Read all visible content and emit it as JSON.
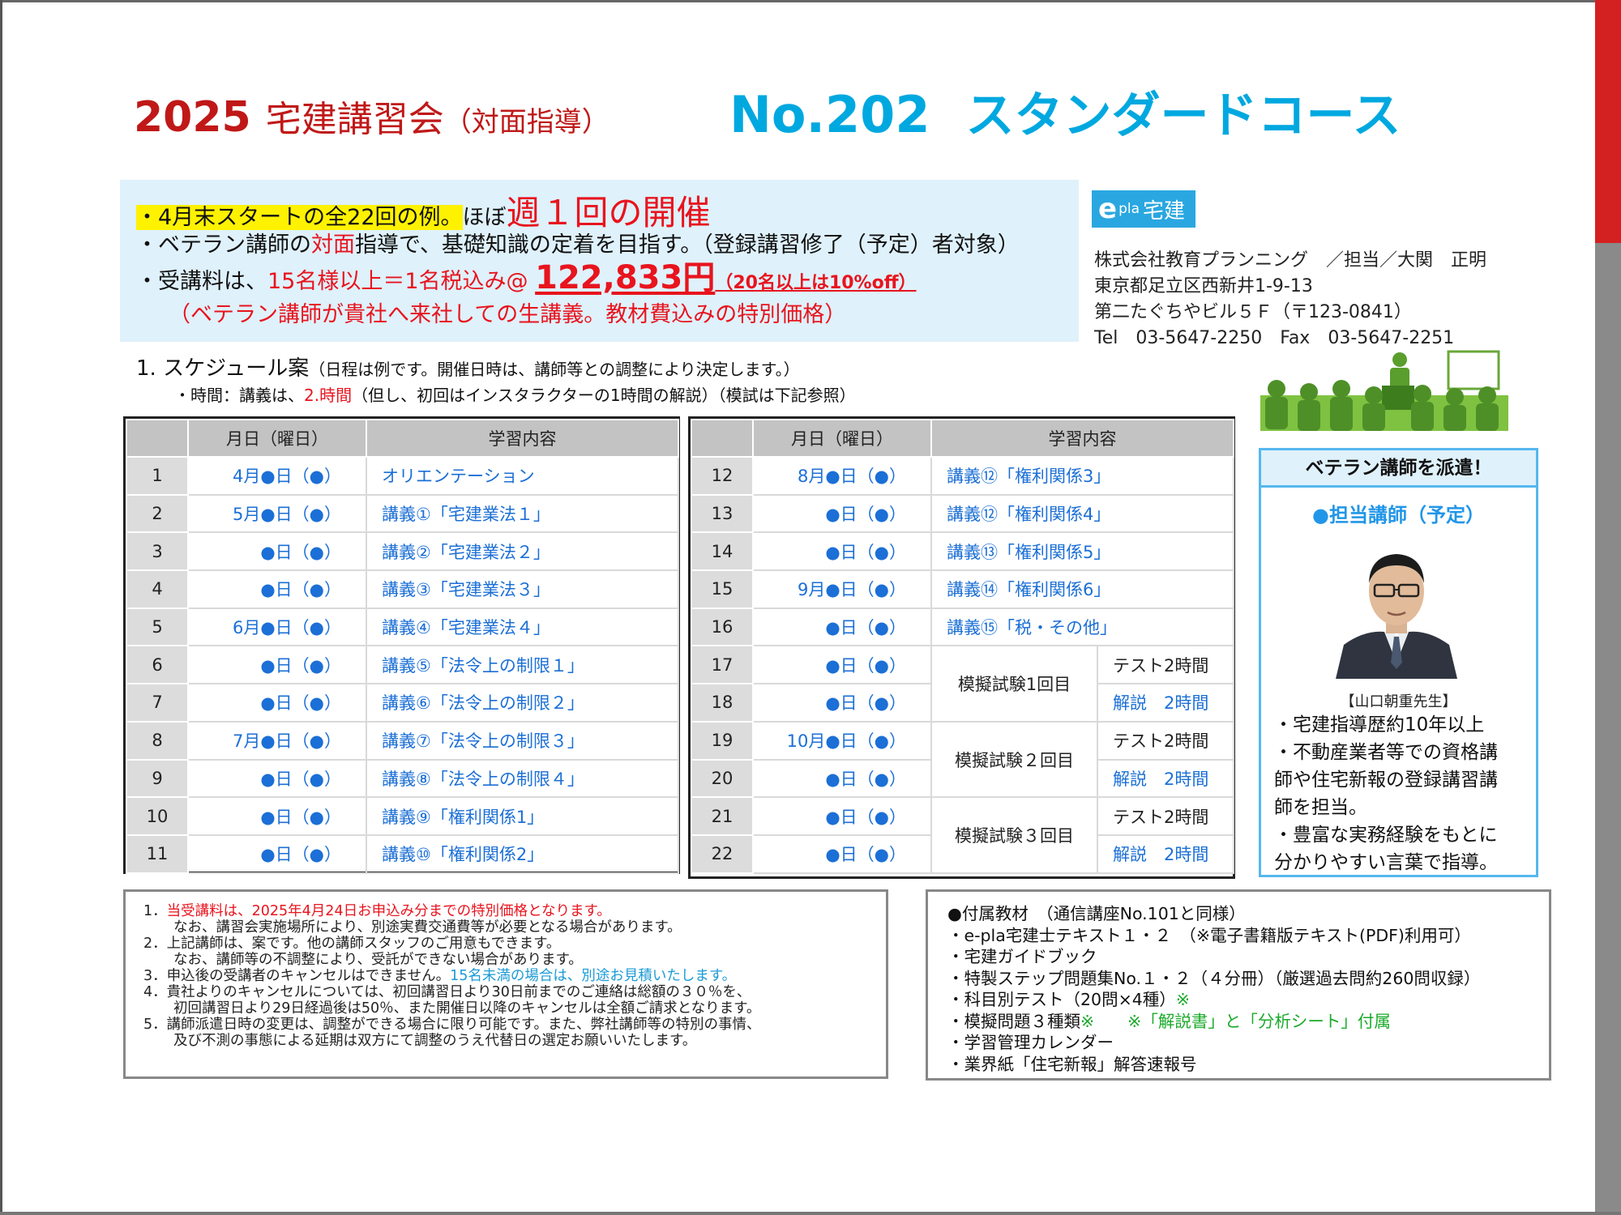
{
  "header": {
    "year": "2025",
    "title": "宅建講習会",
    "title_sub": "（対面指導）",
    "course_no": "No.202",
    "course_name": "スタンダードコース"
  },
  "intro": {
    "line1_hl": "・4月末スタートの全22回の例。",
    "line1_mid": "ほぼ",
    "line1_red": "週１回の開催",
    "line2_a": "・ベテラン講師の",
    "line2_red": "対面",
    "line2_b": "指導で、基礎知識の定着を目指す。（登録講習修了（予定）者対象）",
    "line3_a": "・受講料は、",
    "line3_red": "15名様以上＝1名税込み@",
    "price": "122,833円",
    "discount": "（20名以上は10%off）",
    "line4": "（ベテラン講師が貴社へ来社しての生講義。教材費込みの特別価格）"
  },
  "company": {
    "logo_e": "e",
    "logo_pla": "pla",
    "logo_text": "宅建",
    "lines": [
      "株式会社教育プランニング　／担当／大関　正明",
      "東京都足立区西新井1-9-13",
      "第二たぐちやビル５Ｆ（〒123-0841）",
      "Tel　03-5647-2250　Fax　03-5647-2251"
    ]
  },
  "schedule": {
    "heading": "1.  スケジュール案",
    "heading_note": "（日程は例です。開催日時は、講師等との調整により決定します。）",
    "time_a": "・時間：講義は、",
    "time_red": "2.時間",
    "time_b": "（但し、初回はインスタラクターの1時間の解説）（模試は下記参照）",
    "col_date": "月日（曜日）",
    "col_content": "学習内容",
    "left_rows": [
      {
        "no": "1",
        "date": "4月●日（●）",
        "content": "オリエンテーション"
      },
      {
        "no": "2",
        "date": "5月●日（●）",
        "content": "講義①「宅建業法１」"
      },
      {
        "no": "3",
        "date": "●日（●）",
        "content": "講義②「宅建業法２」"
      },
      {
        "no": "4",
        "date": "●日（●）",
        "content": "講義③「宅建業法３」"
      },
      {
        "no": "5",
        "date": "6月●日（●）",
        "content": "講義④「宅建業法４」"
      },
      {
        "no": "6",
        "date": "●日（●）",
        "content": "講義⑤「法令上の制限１」"
      },
      {
        "no": "7",
        "date": "●日（●）",
        "content": "講義⑥「法令上の制限２」"
      },
      {
        "no": "8",
        "date": "7月●日（●）",
        "content": "講義⑦「法令上の制限３」"
      },
      {
        "no": "9",
        "date": "●日（●）",
        "content": "講義⑧「法令上の制限４」"
      },
      {
        "no": "10",
        "date": "●日（●）",
        "content": "講義⑨「権利関係1」"
      },
      {
        "no": "11",
        "date": "●日（●）",
        "content": "講義⑩「権利関係2」"
      }
    ],
    "right_rows": [
      {
        "no": "12",
        "date": "8月●日（●）",
        "content": "講義⑫「権利関係3」"
      },
      {
        "no": "13",
        "date": "●日（●）",
        "content": "講義⑫「権利関係4」"
      },
      {
        "no": "14",
        "date": "●日（●）",
        "content": "講義⑬「権利関係5」"
      },
      {
        "no": "15",
        "date": "9月●日（●）",
        "content": "講義⑭「権利関係6」"
      },
      {
        "no": "16",
        "date": "●日（●）",
        "content": "講義⑮「税・その他」"
      },
      {
        "no": "17",
        "date": "●日（●）"
      },
      {
        "no": "18",
        "date": "●日（●）"
      },
      {
        "no": "19",
        "date": "10月●日（●）"
      },
      {
        "no": "20",
        "date": "●日（●）"
      },
      {
        "no": "21",
        "date": "●日（●）"
      },
      {
        "no": "22",
        "date": "●日（●）"
      }
    ],
    "exams": [
      {
        "name": "模擬試験1回目",
        "test": "テスト2時間",
        "kaisetsu": "解説　2時間"
      },
      {
        "name": "模擬試験２回目",
        "test": "テスト2時間",
        "kaisetsu": "解説　2時間"
      },
      {
        "name": "模擬試験３回目",
        "test": "テスト2時間",
        "kaisetsu": "解説　2時間"
      }
    ]
  },
  "instructor": {
    "header": "ベテラン講師を派遣！",
    "sub": "●担当講師（予定）",
    "caption": "【山口朝重先生】",
    "bullets": [
      "・宅建指導歴約10年以上",
      "・不動産業者等での資格講",
      "師や住宅新報の登録講習講",
      "師を担当。",
      "・豊富な実務経験をもとに",
      "分かりやすい言葉で指導。"
    ]
  },
  "notes": {
    "n1_no": "1．",
    "n1_red": "当受講料は、2025年4月24日お申込み分までの特別価格となります。",
    "n1_b": "なお、講習会実施場所により、別途実費交通費等が必要となる場合があります。",
    "n2": "2．上記講師は、案です。他の講師スタッフのご用意もできます。",
    "n2_b": "なお、講師等の不調整により、受託ができない場合があります。",
    "n3_a": "3．申込後の受講者のキャンセルはできません。",
    "n3_blue": "15名未満の場合は、別途お見積いたします。",
    "n4": "4．貴社よりのキャンセルについては、初回講習日より30日前までのご連絡は総額の３０％を、",
    "n4_b": "初回講習日より29日経過後は50％、また開催日以降のキャンセルは全額ご請求となります。",
    "n5": "5．講師派遣日時の変更は、調整ができる場合に限り可能です。また、弊社講師等の特別の事情、",
    "n5_b": "及び不測の事態による延期は双方にて調整のうえ代替日の選定お願いいたします。"
  },
  "materials": {
    "head": "●付属教材　（通信講座No.101と同様）",
    "m1": "・e-pla宅建士テキスト１・２　（※電子書籍版テキスト(PDF)利用可）",
    "m2": "・宅建ガイドブック",
    "m3": "・特製ステップ問題集No.１・２（４分冊）（厳選過去問約260問収録）",
    "m4_a": "・科目別テスト（20問×4種）",
    "m4_g": "※",
    "m5_a": "・模擬問題３種類",
    "m5_g": "※　　※「解説書」と「分析シート」付属",
    "m6": "・学習管理カレンダー",
    "m7": "・業界紙「住宅新報」解答速報号"
  },
  "colors": {
    "title_red": "#c01818",
    "course_blue": "#00a8e0",
    "accent_red": "#e8141e",
    "link_blue": "#1b6fd6",
    "intro_bg": "#dff1fb",
    "highlight": "#fff200",
    "note_green": "#1aaa2a"
  }
}
